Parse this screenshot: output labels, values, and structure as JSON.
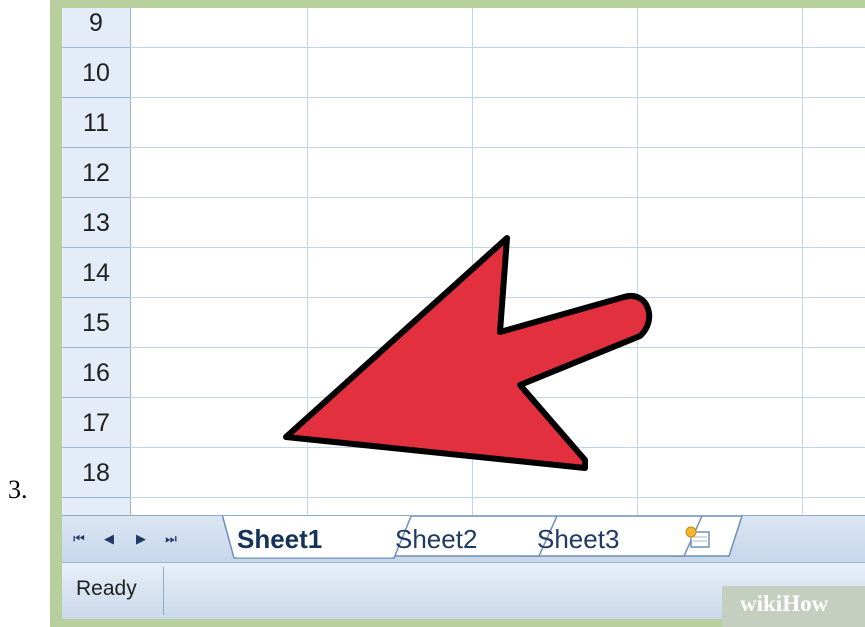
{
  "step_number": "3.",
  "rows": [
    "9",
    "10",
    "11",
    "12",
    "13",
    "14",
    "15",
    "16",
    "17",
    "18"
  ],
  "sheet_tabs": [
    {
      "label": "Sheet1",
      "active": true
    },
    {
      "label": "Sheet2",
      "active": false
    },
    {
      "label": "Sheet3",
      "active": false
    }
  ],
  "nav_buttons": [
    "⏮",
    "◀",
    "▶",
    "⏭"
  ],
  "status": {
    "text": "Ready"
  },
  "watermark": {
    "prefix": "wiki",
    "suffix": "How"
  },
  "colors": {
    "frame": "#b7cf9c",
    "arrow_fill": "#e3303f",
    "arrow_stroke": "#000000",
    "header_bg": "#e4ecf7"
  }
}
